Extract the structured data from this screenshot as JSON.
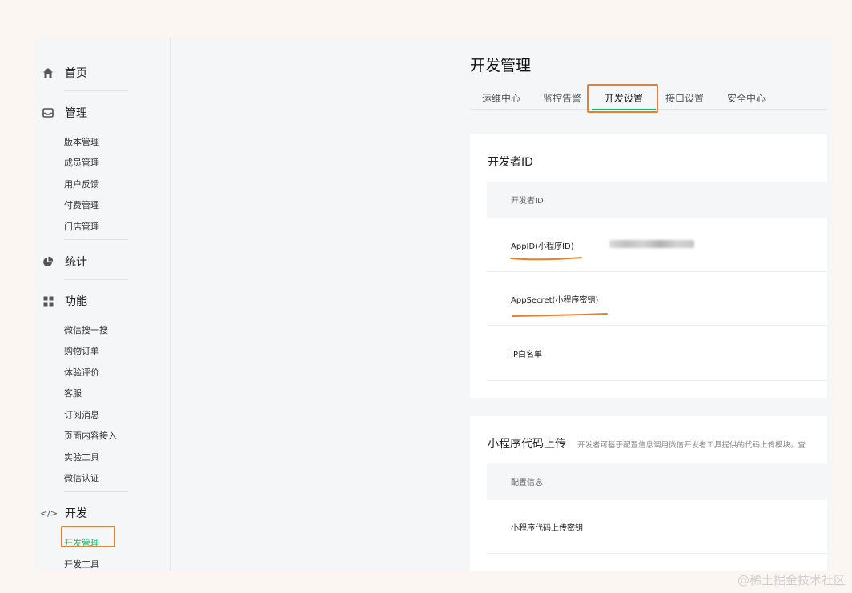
{
  "sidebar": {
    "home": "首页",
    "manage": "管理",
    "manage_items": [
      "版本管理",
      "成员管理",
      "用户反馈",
      "付费管理",
      "门店管理"
    ],
    "stats": "统计",
    "features": "功能",
    "feature_items": [
      "微信搜一搜",
      "购物订单",
      "体验评价",
      "客服",
      "订阅消息",
      "页面内容接入",
      "实验工具",
      "微信认证"
    ],
    "dev": "开发",
    "dev_items": [
      "开发管理",
      "开发工具"
    ],
    "dev_icon_text": "</>"
  },
  "main": {
    "title": "开发管理",
    "tabs": [
      "运维中心",
      "监控告警",
      "开发设置",
      "接口设置",
      "安全中心"
    ],
    "developer_card": {
      "title": "开发者ID",
      "table_header": "开发者ID",
      "rows": [
        "AppID(小程序ID)",
        "AppSecret(小程序密钥)",
        "IP白名单"
      ]
    },
    "upload_card": {
      "title": "小程序代码上传",
      "hint": "开发者可基于配置信息调用微信开发者工具提供的代码上传模块。查",
      "table_header": "配置信息",
      "rows": [
        "小程序代码上传密钥"
      ]
    }
  },
  "watermark": "@稀土掘金技术社区",
  "colors": {
    "accent_green": "#07c160",
    "highlight_orange": "#e8802a"
  }
}
